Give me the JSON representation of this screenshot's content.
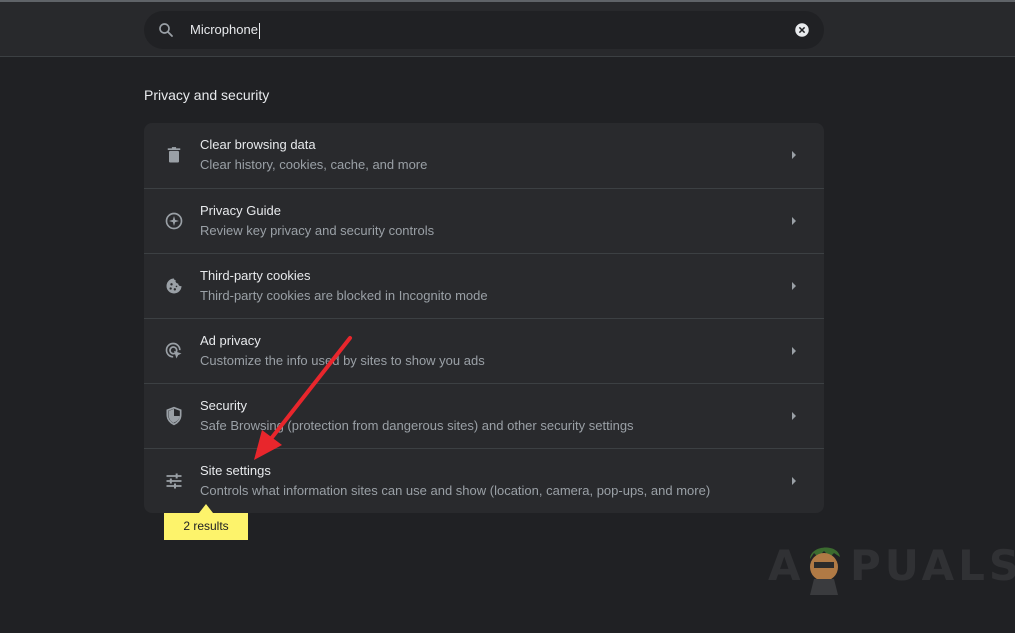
{
  "search": {
    "value": "Microphone"
  },
  "section_title": "Privacy and security",
  "settings_rows": [
    {
      "title": "Clear browsing data",
      "subtitle": "Clear history, cookies, cache, and more",
      "icon": "trash-icon"
    },
    {
      "title": "Privacy Guide",
      "subtitle": "Review key privacy and security controls",
      "icon": "privacy-guide-icon"
    },
    {
      "title": "Third-party cookies",
      "subtitle": "Third-party cookies are blocked in Incognito mode",
      "icon": "cookie-icon"
    },
    {
      "title": "Ad privacy",
      "subtitle": "Customize the info used by sites to show you ads",
      "icon": "ad-privacy-icon"
    },
    {
      "title": "Security",
      "subtitle": "Safe Browsing (protection from dangerous sites) and other security settings",
      "icon": "shield-icon"
    },
    {
      "title": "Site settings",
      "subtitle": "Controls what information sites can use and show (location, camera, pop-ups, and more)",
      "icon": "sliders-icon"
    }
  ],
  "search_results_badge": "2 results",
  "watermark": "APPUALS",
  "colors": {
    "background": "#202124",
    "card": "#292a2d",
    "text_primary": "#e8eaed",
    "text_secondary": "#9aa0a6",
    "tooltip": "#fdf36b",
    "annotation_arrow": "#e8262c"
  }
}
